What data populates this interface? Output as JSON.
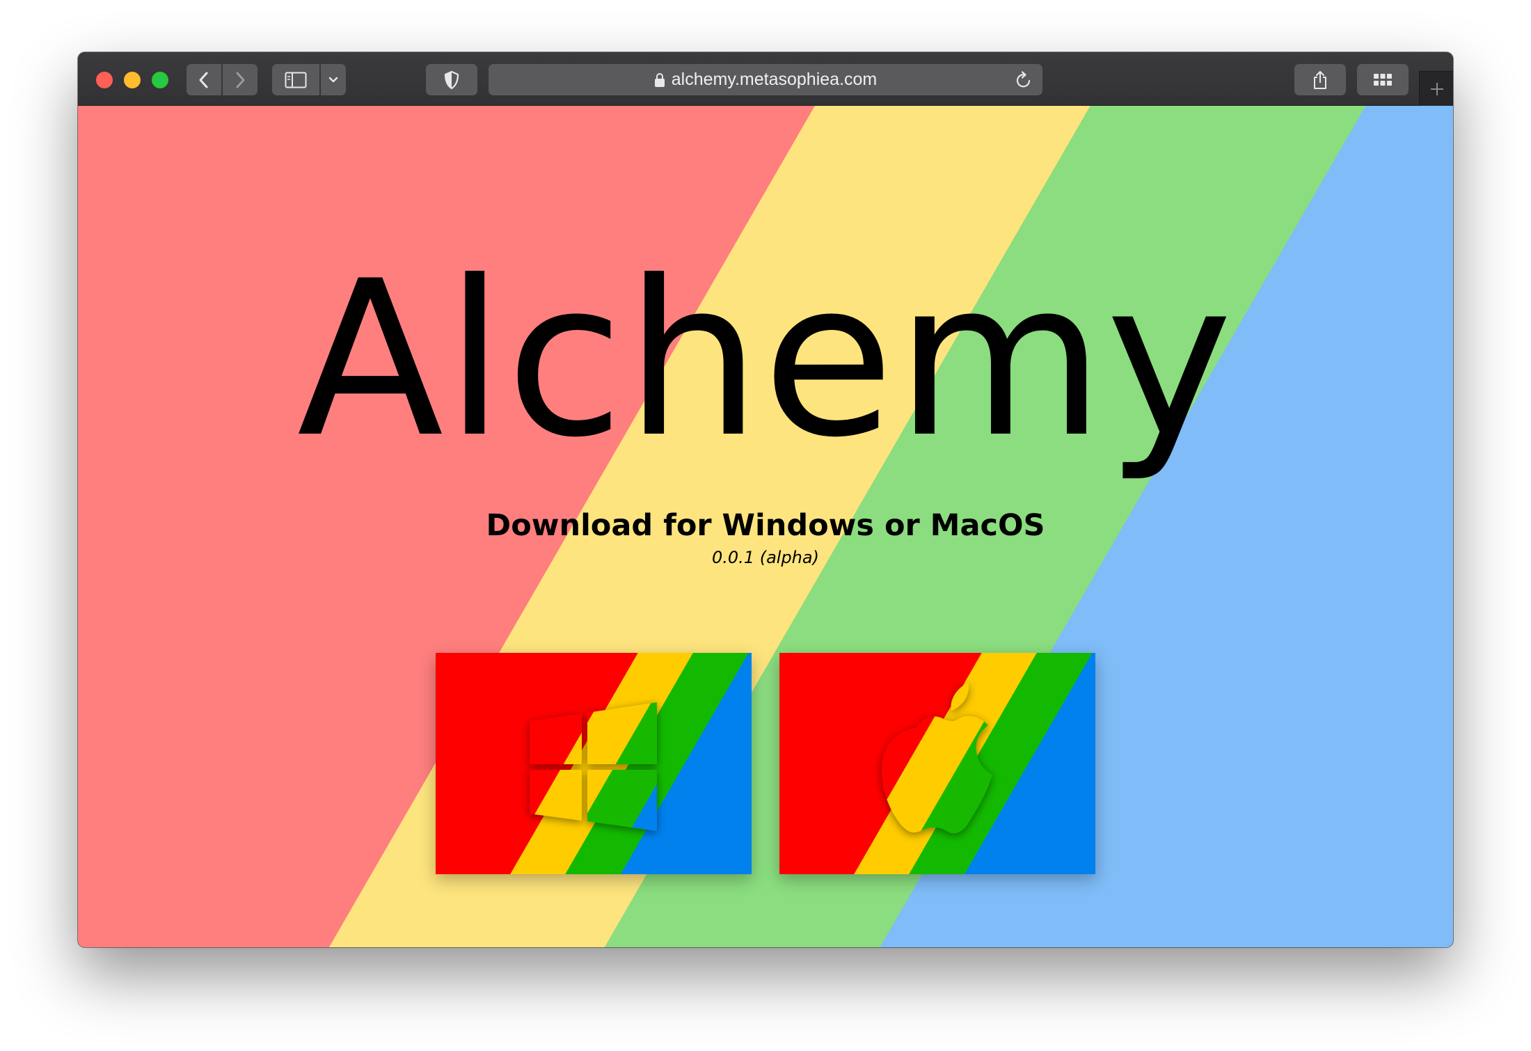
{
  "browser": {
    "url": "alchemy.metasophiea.com",
    "icons": {
      "back": "chevron-left-icon",
      "forward": "chevron-right-icon",
      "sidebar": "sidebar-icon",
      "sidebar_menu": "chevron-down-icon",
      "privacy": "shield-icon",
      "lock": "lock-icon",
      "reload": "reload-icon",
      "share": "share-icon",
      "tabs": "grid-icon",
      "new_tab": "plus-icon"
    }
  },
  "page": {
    "title": "Alchemy",
    "subtitle": "Download for Windows or MacOS",
    "version": "0.0.1 (alpha)",
    "downloads": [
      {
        "platform": "Windows",
        "icon": "windows-logo-icon"
      },
      {
        "platform": "MacOS",
        "icon": "apple-logo-icon"
      }
    ]
  },
  "colors": {
    "stripe_red": "#fe7f7e",
    "stripe_yellow": "#fee47e",
    "stripe_green": "#8bdd7f",
    "stripe_blue": "#7fbcf8",
    "tile_red": "#fe0000",
    "tile_yellow": "#ffcc00",
    "tile_green": "#12b900",
    "tile_blue": "#0081ee"
  }
}
